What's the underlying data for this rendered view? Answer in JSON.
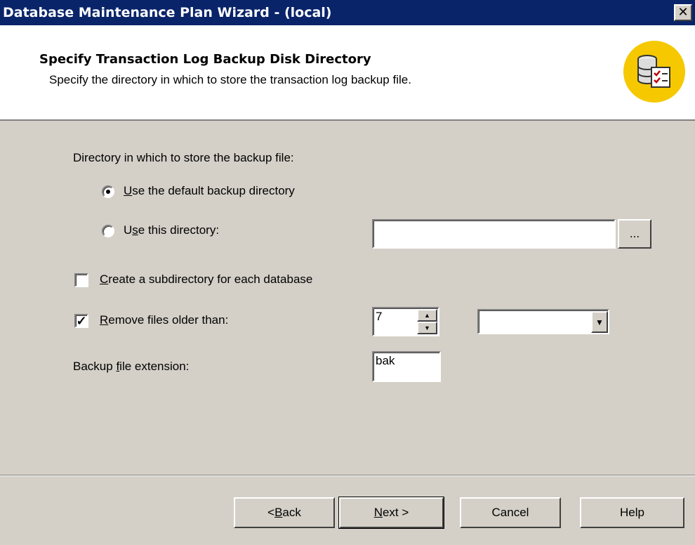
{
  "window": {
    "title": "Database Maintenance Plan Wizard - (local)",
    "close_glyph": "✕"
  },
  "header": {
    "title": "Specify Transaction Log Backup Disk Directory",
    "subtitle": "Specify the directory in which to store the transaction log backup file.",
    "icon": "database-checklist-icon"
  },
  "directory": {
    "group_label": "Directory in which to store the backup file:",
    "default_option": {
      "mnemonic": "U",
      "rest": "se the default backup directory",
      "selected": true
    },
    "custom_option": {
      "pre": "U",
      "mnemonic": "s",
      "rest": "e this directory:",
      "selected": false
    },
    "custom_path_value": "",
    "browse_label": "..."
  },
  "subdirectory": {
    "mnemonic": "C",
    "rest": "reate a subdirectory for each database",
    "checked": false
  },
  "remove_files": {
    "mnemonic": "R",
    "rest": "emove files older than:",
    "checked": true,
    "value": "7",
    "unit_selected": ""
  },
  "extension": {
    "label_pre": "Backup ",
    "mnemonic": "f",
    "label_rest": "ile extension:",
    "value": "bak"
  },
  "buttons": {
    "back": {
      "pre": "< ",
      "mnemonic": "B",
      "rest": "ack"
    },
    "next": {
      "mnemonic": "N",
      "rest": "ext >"
    },
    "cancel": "Cancel",
    "help": "Help"
  },
  "colors": {
    "titlebar": "#0a246a",
    "dialog_bg": "#d4d0c8",
    "logo": "#f5c800"
  }
}
